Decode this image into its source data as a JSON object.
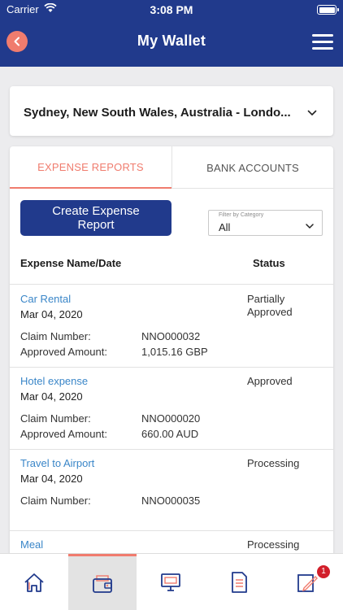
{
  "status_bar": {
    "carrier": "Carrier",
    "time": "3:08 PM"
  },
  "header": {
    "title": "My Wallet",
    "back_icon": "chevron-left-icon",
    "menu_icon": "hamburger-icon"
  },
  "location": {
    "value": "Sydney, New South Wales, Australia - Londo..."
  },
  "tabs": [
    {
      "label": "EXPENSE REPORTS",
      "active": true
    },
    {
      "label": "BANK ACCOUNTS",
      "active": false
    }
  ],
  "create_button": {
    "label_line1": "Create Expense",
    "label_line2": "Report"
  },
  "filter": {
    "label": "Filter by Category",
    "value": "All"
  },
  "table": {
    "col_name": "Expense Name/Date",
    "col_status": "Status",
    "rows": [
      {
        "title": "Car Rental",
        "date": "Mar 04, 2020",
        "status": "Partially Approved",
        "claim_label": "Claim Number:",
        "claim_value": "NNO000032",
        "amount_label": "Approved Amount:",
        "amount_value": "1,015.16 GBP"
      },
      {
        "title": "Hotel expense",
        "date": "Mar 04, 2020",
        "status": "Approved",
        "claim_label": "Claim Number:",
        "claim_value": "NNO000020",
        "amount_label": "Approved Amount:",
        "amount_value": "660.00 AUD"
      },
      {
        "title": "Travel to Airport",
        "date": "Mar 04, 2020",
        "status": "Processing",
        "claim_label": "Claim Number:",
        "claim_value": "NNO000035"
      },
      {
        "title": "Meal",
        "status": "Processing"
      }
    ]
  },
  "bottom_nav": {
    "items": [
      {
        "icon": "home-icon"
      },
      {
        "icon": "wallet-icon",
        "active": true
      },
      {
        "icon": "monitor-icon"
      },
      {
        "icon": "document-icon"
      },
      {
        "icon": "edit-document-icon",
        "badge": "1"
      }
    ],
    "accent": "#f07c6e"
  },
  "colors": {
    "brand": "#213a8c",
    "accent": "#f07c6e",
    "link": "#3a86c8",
    "badge": "#d21e2a"
  }
}
